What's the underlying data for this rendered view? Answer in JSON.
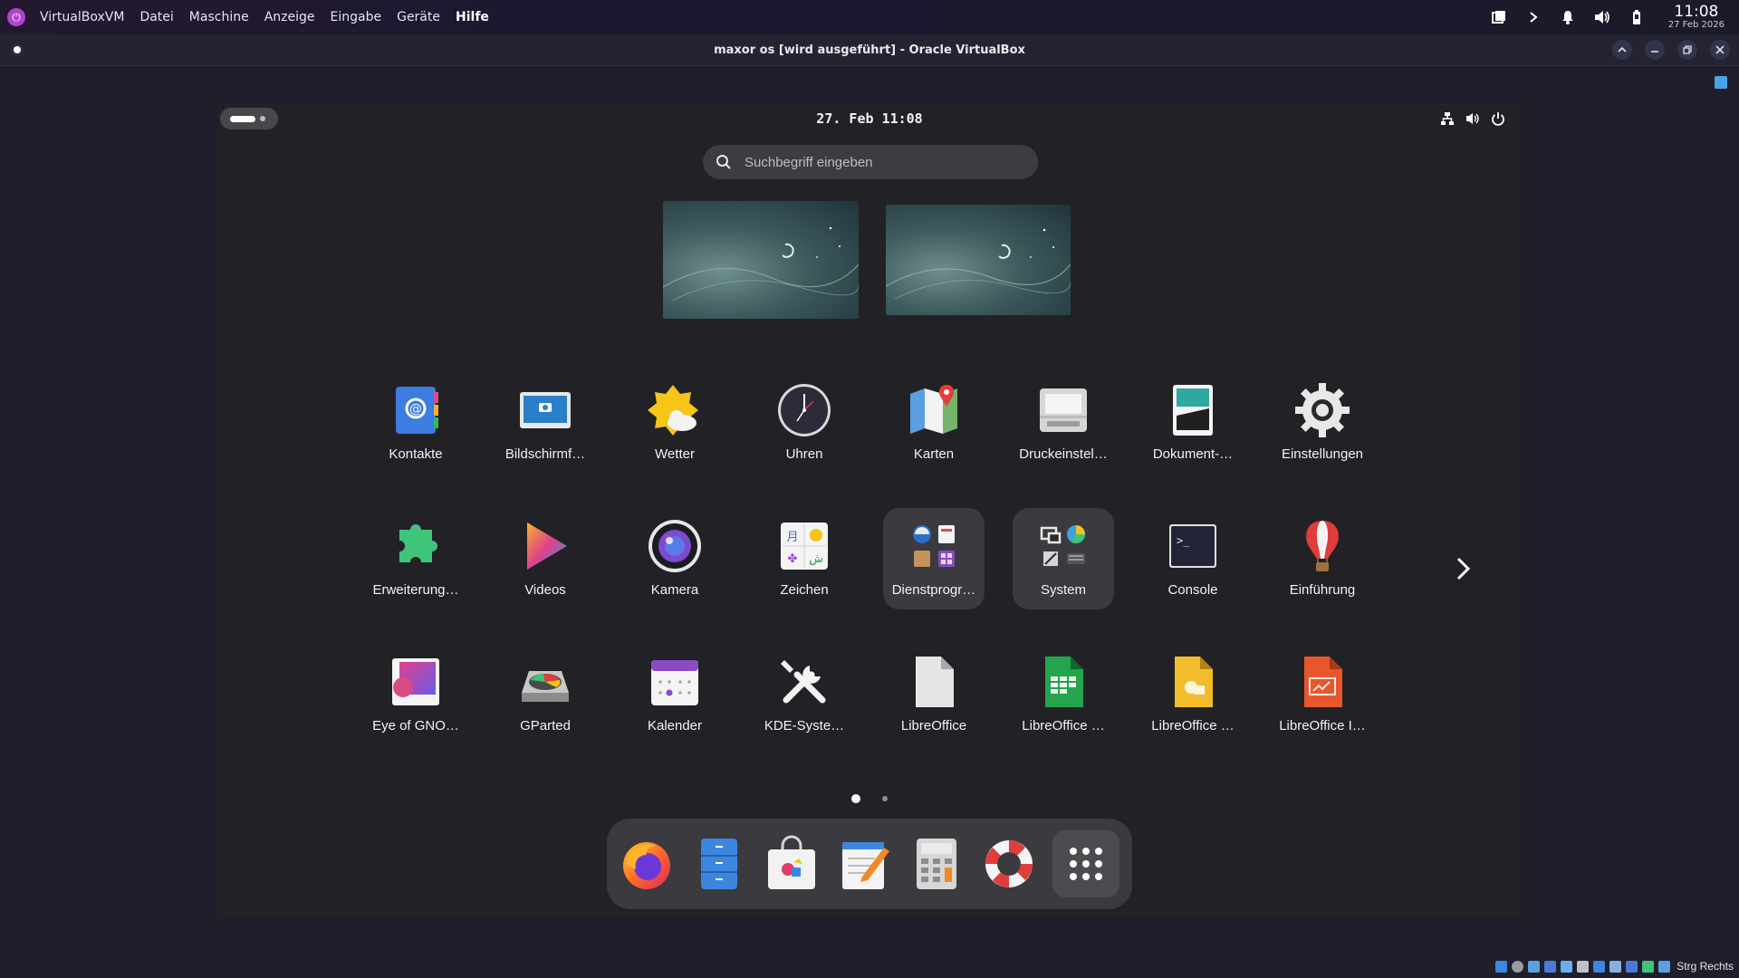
{
  "host": {
    "app_name": "VirtualBoxVM",
    "menu": [
      {
        "label": "Datei"
      },
      {
        "label": "Maschine"
      },
      {
        "label": "Anzeige"
      },
      {
        "label": "Eingabe"
      },
      {
        "label": "Geräte"
      },
      {
        "label": "Hilfe"
      }
    ],
    "clock_time": "11:08",
    "clock_date": "27 Feb 2026"
  },
  "window": {
    "title": "maxor os [wird ausgeführt] - Oracle VirtualBox"
  },
  "guest": {
    "clock": "27. Feb 11:08",
    "search_placeholder": "Suchbegriff eingeben",
    "apps": [
      {
        "label": "Kontakte",
        "icon": "contacts-icon"
      },
      {
        "label": "Bildschirmf…",
        "icon": "screenshot-icon"
      },
      {
        "label": "Wetter",
        "icon": "weather-icon"
      },
      {
        "label": "Uhren",
        "icon": "clock-icon"
      },
      {
        "label": "Karten",
        "icon": "maps-icon"
      },
      {
        "label": "Druckeinstel…",
        "icon": "printer-icon"
      },
      {
        "label": "Dokument-…",
        "icon": "document-scanner-icon"
      },
      {
        "label": "Einstellungen",
        "icon": "settings-icon"
      },
      {
        "label": "Erweiterung…",
        "icon": "extensions-icon"
      },
      {
        "label": "Videos",
        "icon": "videos-icon"
      },
      {
        "label": "Kamera",
        "icon": "camera-icon"
      },
      {
        "label": "Zeichen",
        "icon": "characters-icon"
      },
      {
        "label": "Dienstprogr…",
        "icon": "utilities-folder-icon"
      },
      {
        "label": "System",
        "icon": "system-folder-icon"
      },
      {
        "label": "Console",
        "icon": "console-icon"
      },
      {
        "label": "Einführung",
        "icon": "tour-icon"
      },
      {
        "label": "Eye of GNO…",
        "icon": "image-viewer-icon"
      },
      {
        "label": "GParted",
        "icon": "gparted-icon"
      },
      {
        "label": "Kalender",
        "icon": "calendar-icon"
      },
      {
        "label": "KDE-Syste…",
        "icon": "kde-system-settings-icon"
      },
      {
        "label": "LibreOffice",
        "icon": "libreoffice-icon"
      },
      {
        "label": "LibreOffice …",
        "icon": "libreoffice-calc-icon"
      },
      {
        "label": "LibreOffice …",
        "icon": "libreoffice-impress-icon"
      },
      {
        "label": "LibreOffice I…",
        "icon": "libreoffice-impress-orange-icon"
      }
    ],
    "dock": [
      {
        "icon": "firefox-icon"
      },
      {
        "icon": "files-icon"
      },
      {
        "icon": "software-icon"
      },
      {
        "icon": "text-editor-icon"
      },
      {
        "icon": "calculator-icon"
      },
      {
        "icon": "help-icon"
      },
      {
        "icon": "app-grid-icon"
      }
    ]
  },
  "status_bar": {
    "host_key": "Strg Rechts"
  },
  "colors": {
    "host_bg": "#1f1f2c",
    "guest_bg": "#222226",
    "tile_highlight": "#3a3a3f",
    "accent_purple": "#b043d1"
  }
}
